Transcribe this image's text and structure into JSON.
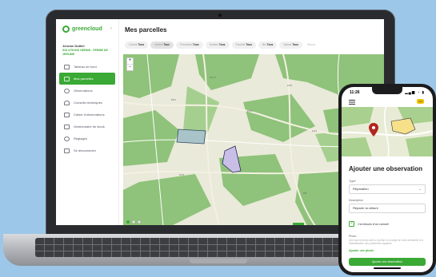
{
  "app": {
    "brand": "greencloud",
    "page_title": "Mes parcelles"
  },
  "sidebar": {
    "user_name": "Jerome Dutilel",
    "farm_name": "SOLUTIONS GERMS - FERME DE JEROME",
    "items": [
      {
        "label": "Tableau de bord",
        "icon": "dashboard-icon"
      },
      {
        "label": "Mes parcelles",
        "icon": "map-icon",
        "active": true
      },
      {
        "label": "Observations",
        "icon": "eye-icon"
      },
      {
        "label": "Conseils techniques",
        "icon": "lightbulb-icon"
      },
      {
        "label": "Cahier d'observations",
        "icon": "notebook-icon"
      },
      {
        "label": "Gestionnaire de stock",
        "icon": "stock-icon"
      },
      {
        "label": "Réglages",
        "icon": "gear-icon"
      },
      {
        "label": "Se déconnecter",
        "icon": "logout-icon"
      }
    ]
  },
  "filters": [
    {
      "name": "Culture",
      "value": "Tous"
    },
    {
      "name": "Variété",
      "value": "Tous",
      "selected": true
    },
    {
      "name": "Précédent",
      "value": "Tous"
    },
    {
      "name": "Surface",
      "value": "Tous"
    },
    {
      "name": "Parcelle",
      "value": "Tous"
    },
    {
      "name": "Bio",
      "value": "Tous"
    },
    {
      "name": "Saison",
      "value": "Tous"
    }
  ],
  "filters_more": "Effacer",
  "map": {
    "zoom_in": "+",
    "zoom_out": "−",
    "road_labels": [
      "D51",
      "D29",
      "D44",
      "D117",
      "D35",
      "D70",
      "D8",
      "D36"
    ]
  },
  "phone": {
    "time": "11:26",
    "status_icons": "▂▄▆ ◔ ▮",
    "nav_badge": "GR",
    "form_title": "Ajouter une observation",
    "type_label": "Type*",
    "type_value": "Réparation",
    "description_label": "Description",
    "description_value": "Réparer la clôture",
    "checkbox_label": "J'ai besoin d'un conseil",
    "checkbox_mark": "✓",
    "photo_label": "Photo",
    "photo_help": "Une bonne photo aide à la prise en charge de votre demande et à l'identification des problèmes signalés",
    "add_photo_label": "Ajouter une photo",
    "submit_label": "Ajouter une observation"
  },
  "colors": {
    "brand_green": "#3aa935",
    "map_green": "#8fc27a",
    "parcel_fill_1": "#a8c4c9",
    "parcel_fill_2": "#c9bfe6",
    "background": "#9cc7e8"
  }
}
